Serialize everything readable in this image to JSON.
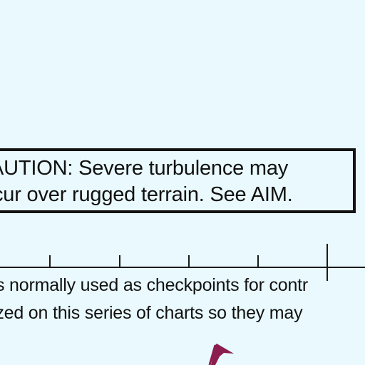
{
  "caution": {
    "line1": "AUTION: Severe turbulence may",
    "line2": "cur over rugged terrain. See AIM."
  },
  "note": {
    "line1": "s normally used as checkpoints for contr",
    "line2": "ized on this series of charts so they may"
  },
  "colors": {
    "background": "#e9f9fd",
    "ink": "#111111",
    "flag": "#8b1e4e"
  },
  "icons": {
    "flag": "visual-checkpoint-flag-icon"
  }
}
